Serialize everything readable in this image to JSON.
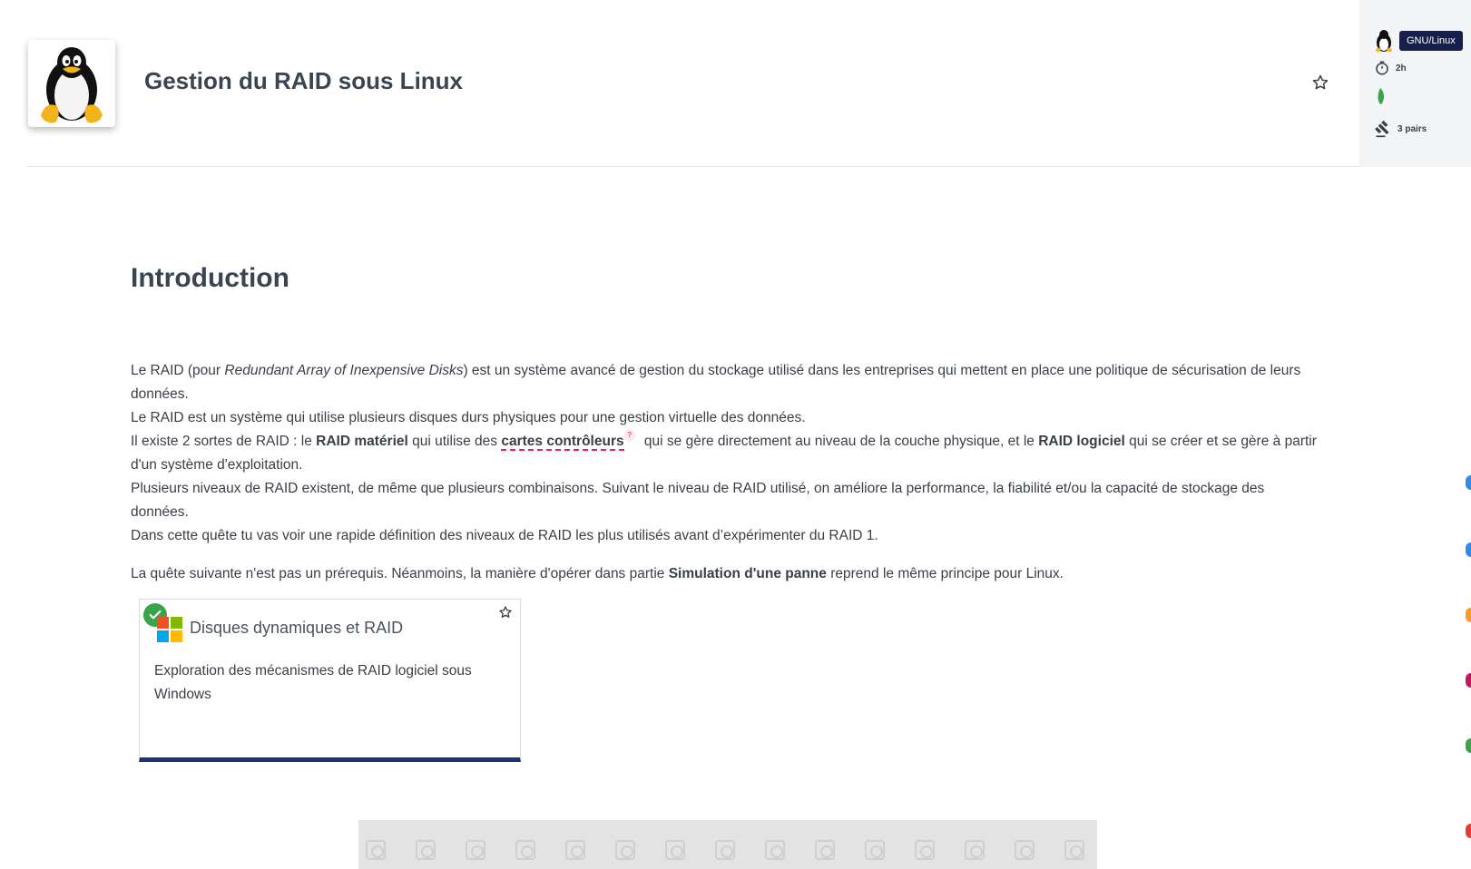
{
  "header": {
    "title": "Gestion du RAID sous Linux",
    "logo_icon": "tux-penguin-icon"
  },
  "side": {
    "platform": "GNU/Linux",
    "duration": "2h",
    "level_icon": "green-leaf-icon",
    "evaluation": "3 pairs"
  },
  "intro": {
    "heading": "Introduction",
    "p1_a": "Le RAID (pour ",
    "p1_b": "Redundant Array of Inexpensive Disks",
    "p1_c": ") est un système avancé de gestion du stockage utilisé dans les entreprises qui mettent en place une politique de sécurisation de leurs données.",
    "p2": "Le RAID est un système qui utilise plusieurs disques durs physiques pour une gestion virtuelle des données.",
    "p3_a": "Il existe 2 sortes de RAID : le ",
    "p3_b": "RAID matériel",
    "p3_c": " qui utilise des ",
    "p3_d": "cartes contrôleurs",
    "p3_tip": "?",
    "p3_e": " qui se gère directement au niveau de la couche physique, et le ",
    "p3_f": "RAID logiciel",
    "p3_g": " qui se créer et se gère à partir d'un système d'exploitation.",
    "p4": "Plusieurs niveaux de RAID existent, de même que plusieurs combinaisons. Suivant le niveau de RAID utilisé, on améliore la performance, la fiabilité et/ou la capacité de stockage des données.",
    "p5": "Dans cette quête tu vas voir une rapide définition des niveaux de RAID les plus utilisés avant d’expérimenter du RAID 1.",
    "p6_a": "La quête suivante n'est pas un prérequis. Néanmoins, la manière d'opérer dans partie ",
    "p6_b": "Simulation d'une panne",
    "p6_c": " reprend le même principe pour Linux."
  },
  "card": {
    "title": "Disques dynamiques et RAID",
    "description": "Exploration des mécanismes de RAID logiciel sous Windows",
    "status_icon": "check-icon",
    "logo_icon": "windows-logo-icon"
  },
  "colors": {
    "accent": "#17204a",
    "card_border": "#1f3372",
    "tooltip": "#e91e63",
    "success": "#3aa44a"
  }
}
